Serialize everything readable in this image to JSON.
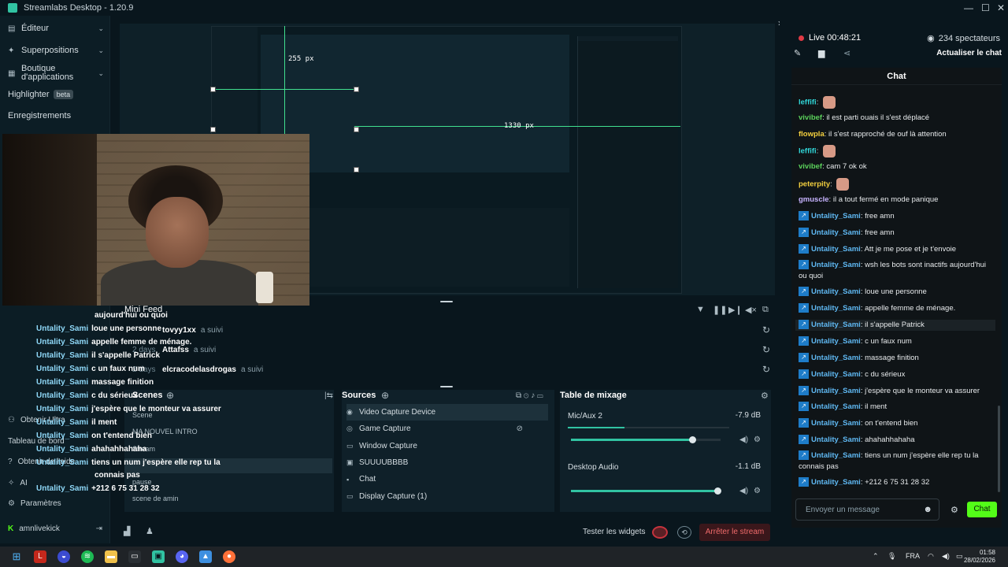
{
  "app": {
    "title": "Streamlabs Desktop - 1.20.9",
    "minimize": "—",
    "maximize": "☐",
    "close": "✕",
    "collapse_arrow": "›"
  },
  "sidebar": {
    "items": [
      {
        "icon": "editor-icon",
        "label": "Éditeur"
      },
      {
        "icon": "overlays-icon",
        "label": "Superpositions"
      },
      {
        "icon": "store-icon",
        "label": "Boutique d'applications"
      },
      {
        "icon": "highlighter-icon",
        "label": "Highlighter",
        "badge": "beta"
      },
      {
        "icon": "recordings-icon",
        "label": "Enregistrements"
      }
    ],
    "bottom": [
      {
        "icon": "user-icon",
        "label": "Obtenir Ultra"
      },
      {
        "icon": "dashboard-icon",
        "label": "Tableau de bord"
      },
      {
        "icon": "help-icon",
        "label": "Obtenir de l'aide"
      },
      {
        "icon": "ai-icon",
        "label": "AI"
      },
      {
        "icon": "settings-icon",
        "label": "Paramètres"
      }
    ],
    "account": "amnlivekick"
  },
  "preview": {
    "measure_top": "255 px",
    "measure_right": "1330 px"
  },
  "minifeed": {
    "title": "Mini Feed",
    "rows": [
      {
        "time": "",
        "name": "tovyy1xx",
        "action": "a suivi"
      },
      {
        "time": "2 days",
        "name": "Attafss",
        "action": "a suivi"
      },
      {
        "time": "2 days",
        "name": "elcracodelasdrogas",
        "action": "a suivi"
      }
    ]
  },
  "overlay_chat": [
    {
      "user": "",
      "msg": "aujourd'hui ou quoi"
    },
    {
      "user": "Untality_Sami",
      "msg": "loue une personne"
    },
    {
      "user": "Untality_Sami",
      "msg": "appelle femme de ménage."
    },
    {
      "user": "Untality_Sami",
      "msg": "il s'appelle Patrick"
    },
    {
      "user": "Untality_Sami",
      "msg": "c un faux num"
    },
    {
      "user": "Untality_Sami",
      "msg": "massage finition"
    },
    {
      "user": "Untality_Sami",
      "msg": "c du sérieux"
    },
    {
      "user": "Untality_Sami",
      "msg": "j'espère que le monteur va assurer"
    },
    {
      "user": "Untality_Sami",
      "msg": "il ment"
    },
    {
      "user": "Untality_Sami",
      "msg": "on t'entend bien"
    },
    {
      "user": "Untality_Sami",
      "msg": "ahahahhahaha"
    },
    {
      "user": "Untality_Sami",
      "msg": "tiens un num j'espère elle rep tu la"
    },
    {
      "user": "",
      "msg": "connais pas"
    },
    {
      "user": "Untality_Sami",
      "msg": "+212 6 75 31 28 32"
    }
  ],
  "scenes": {
    "title": "Scenes",
    "items": [
      "Scene",
      "MA NOUVEL INTRO",
      "Stream",
      "pause",
      "scene de amin"
    ]
  },
  "sources": {
    "title": "Sources",
    "items": [
      {
        "icon": "camera-icon",
        "label": "Video Capture Device",
        "active": true
      },
      {
        "icon": "gamepad-icon",
        "label": "Game Capture"
      },
      {
        "icon": "window-icon",
        "label": "Window Capture"
      },
      {
        "icon": "image-icon",
        "label": "SUUUUBBBB"
      },
      {
        "icon": "chat-icon",
        "label": "Chat"
      },
      {
        "icon": "monitor-icon",
        "label": "Display Capture (1)"
      }
    ]
  },
  "mixer": {
    "title": "Table de mixage",
    "tracks": [
      {
        "name": "Mic/Aux 2",
        "db": "-7.9 dB",
        "meter": 0.35,
        "volume": 0.81
      },
      {
        "name": "Desktop Audio",
        "db": "-1.1 dB",
        "meter": 0.0,
        "volume": 0.98
      }
    ]
  },
  "footer": {
    "test_widgets": "Tester les widgets",
    "stop_stream": "Arrêter le stream"
  },
  "right": {
    "live_label": "Live",
    "live_time": "00:48:21",
    "viewers": "234 spectateurs",
    "refresh_chat": "Actualiser le chat",
    "chat_title": "Chat",
    "input_placeholder": "Envoyer un message",
    "send": "Chat"
  },
  "chat_messages": [
    {
      "user": "leffifi",
      "msg": "",
      "color": "#31d7d9",
      "emote": true,
      "kick": false
    },
    {
      "user": "vivibef",
      "msg": "il est parti ouais il s'est déplacé",
      "color": "#5bd15b",
      "emote": false,
      "kick": false
    },
    {
      "user": "flowpla",
      "msg": "il s'est rapproché de ouf là attention",
      "color": "#f4d03f",
      "emote": false,
      "kick": false
    },
    {
      "user": "leffifi",
      "msg": "",
      "color": "#31d7d9",
      "emote": true,
      "kick": false
    },
    {
      "user": "vivibef",
      "msg": "cam 7 ok ok",
      "color": "#5bd15b",
      "emote": false,
      "kick": false
    },
    {
      "user": "peterpity",
      "msg": "",
      "color": "#f4d03f",
      "emote": true,
      "kick": false
    },
    {
      "user": "gmuscle",
      "msg": "il a tout fermé en mode panique",
      "color": "#c7b3ff",
      "emote": false,
      "kick": false
    },
    {
      "user": "Untality_Sami",
      "msg": "free amn",
      "color": "#5fb8f2",
      "emote": false,
      "kick": true
    },
    {
      "user": "Untality_Sami",
      "msg": "free amn",
      "color": "#5fb8f2",
      "emote": false,
      "kick": true
    },
    {
      "user": "Untality_Sami",
      "msg": "Att je me pose et je t'envoie",
      "color": "#5fb8f2",
      "emote": false,
      "kick": true
    },
    {
      "user": "Untality_Sami",
      "msg": "wsh les bots sont inactifs aujourd'hui ou quoi",
      "color": "#5fb8f2",
      "emote": false,
      "kick": true
    },
    {
      "user": "Untality_Sami",
      "msg": "loue une personne",
      "color": "#5fb8f2",
      "emote": false,
      "kick": true
    },
    {
      "user": "Untality_Sami",
      "msg": "appelle femme de ménage.",
      "color": "#5fb8f2",
      "emote": false,
      "kick": true
    },
    {
      "user": "Untality_Sami",
      "msg": "il s'appelle Patrick",
      "color": "#5fb8f2",
      "emote": false,
      "kick": true,
      "highlight": true
    },
    {
      "user": "Untality_Sami",
      "msg": "c un faux num",
      "color": "#5fb8f2",
      "emote": false,
      "kick": true
    },
    {
      "user": "Untality_Sami",
      "msg": "massage finition",
      "color": "#5fb8f2",
      "emote": false,
      "kick": true
    },
    {
      "user": "Untality_Sami",
      "msg": "c du sérieux",
      "color": "#5fb8f2",
      "emote": false,
      "kick": true
    },
    {
      "user": "Untality_Sami",
      "msg": "j'espère que le monteur va assurer",
      "color": "#5fb8f2",
      "emote": false,
      "kick": true
    },
    {
      "user": "Untality_Sami",
      "msg": "il ment",
      "color": "#5fb8f2",
      "emote": false,
      "kick": true
    },
    {
      "user": "Untality_Sami",
      "msg": "on t'entend bien",
      "color": "#5fb8f2",
      "emote": false,
      "kick": true
    },
    {
      "user": "Untality_Sami",
      "msg": "ahahahhahaha",
      "color": "#5fb8f2",
      "emote": false,
      "kick": true
    },
    {
      "user": "Untality_Sami",
      "msg": "tiens un num j'espère elle rep tu la connais pas",
      "color": "#5fb8f2",
      "emote": false,
      "kick": true
    },
    {
      "user": "Untality_Sami",
      "msg": "+212 6 75 31 28 32",
      "color": "#5fb8f2",
      "emote": false,
      "kick": true
    }
  ],
  "taskbar": {
    "lang": "FRA",
    "time": "01:58",
    "date": "28/02/2026"
  }
}
